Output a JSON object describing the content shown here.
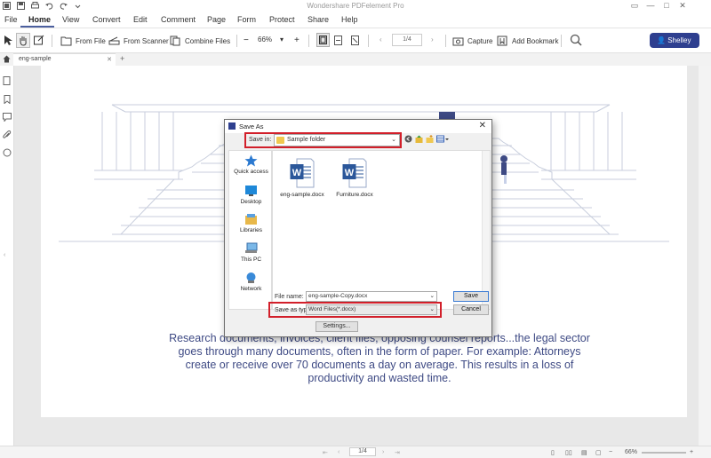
{
  "app": {
    "window_title": "Wondershare PDFelement Pro"
  },
  "menu": {
    "items": [
      "File",
      "Home",
      "View",
      "Convert",
      "Edit",
      "Comment",
      "Page",
      "Form",
      "Protect",
      "Share",
      "Help"
    ],
    "active": "Home"
  },
  "toolbar": {
    "from_file": "From File",
    "from_scanner": "From Scanner",
    "combine_files": "Combine Files",
    "zoom": "66%",
    "page_indicator": "1/4",
    "capture": "Capture",
    "add_bookmark": "Add Bookmark",
    "user": "Shelley"
  },
  "tabs": {
    "current": "eng-sample"
  },
  "document": {
    "paragraph": "Research documents, invoices, client files, opposing counsel reports...the legal sector goes through many documents, often in the form of paper. For example: Attorneys create or receive over 70 documents a day on average. This results in a loss of productivity and wasted time."
  },
  "status": {
    "page": "1/4",
    "zoom": "66%"
  },
  "dialog": {
    "title": "Save As",
    "save_in_label": "Save in:",
    "save_in_value": "Sample folder",
    "places": [
      "Quick access",
      "Desktop",
      "Libraries",
      "This PC",
      "Network"
    ],
    "files": [
      "eng-sample.docx",
      "Furniture.docx"
    ],
    "file_name_label": "File name:",
    "file_name_value": "eng-sample-Copy.docx",
    "save_type_label": "Save as type:",
    "save_type_value": "Word Files(*.docx)",
    "save_button": "Save",
    "cancel_button": "Cancel",
    "settings_button": "Settings..."
  },
  "colors": {
    "accent": "#2e3f8f",
    "doc_text": "#3e4a84",
    "highlight": "#d21f2a"
  }
}
